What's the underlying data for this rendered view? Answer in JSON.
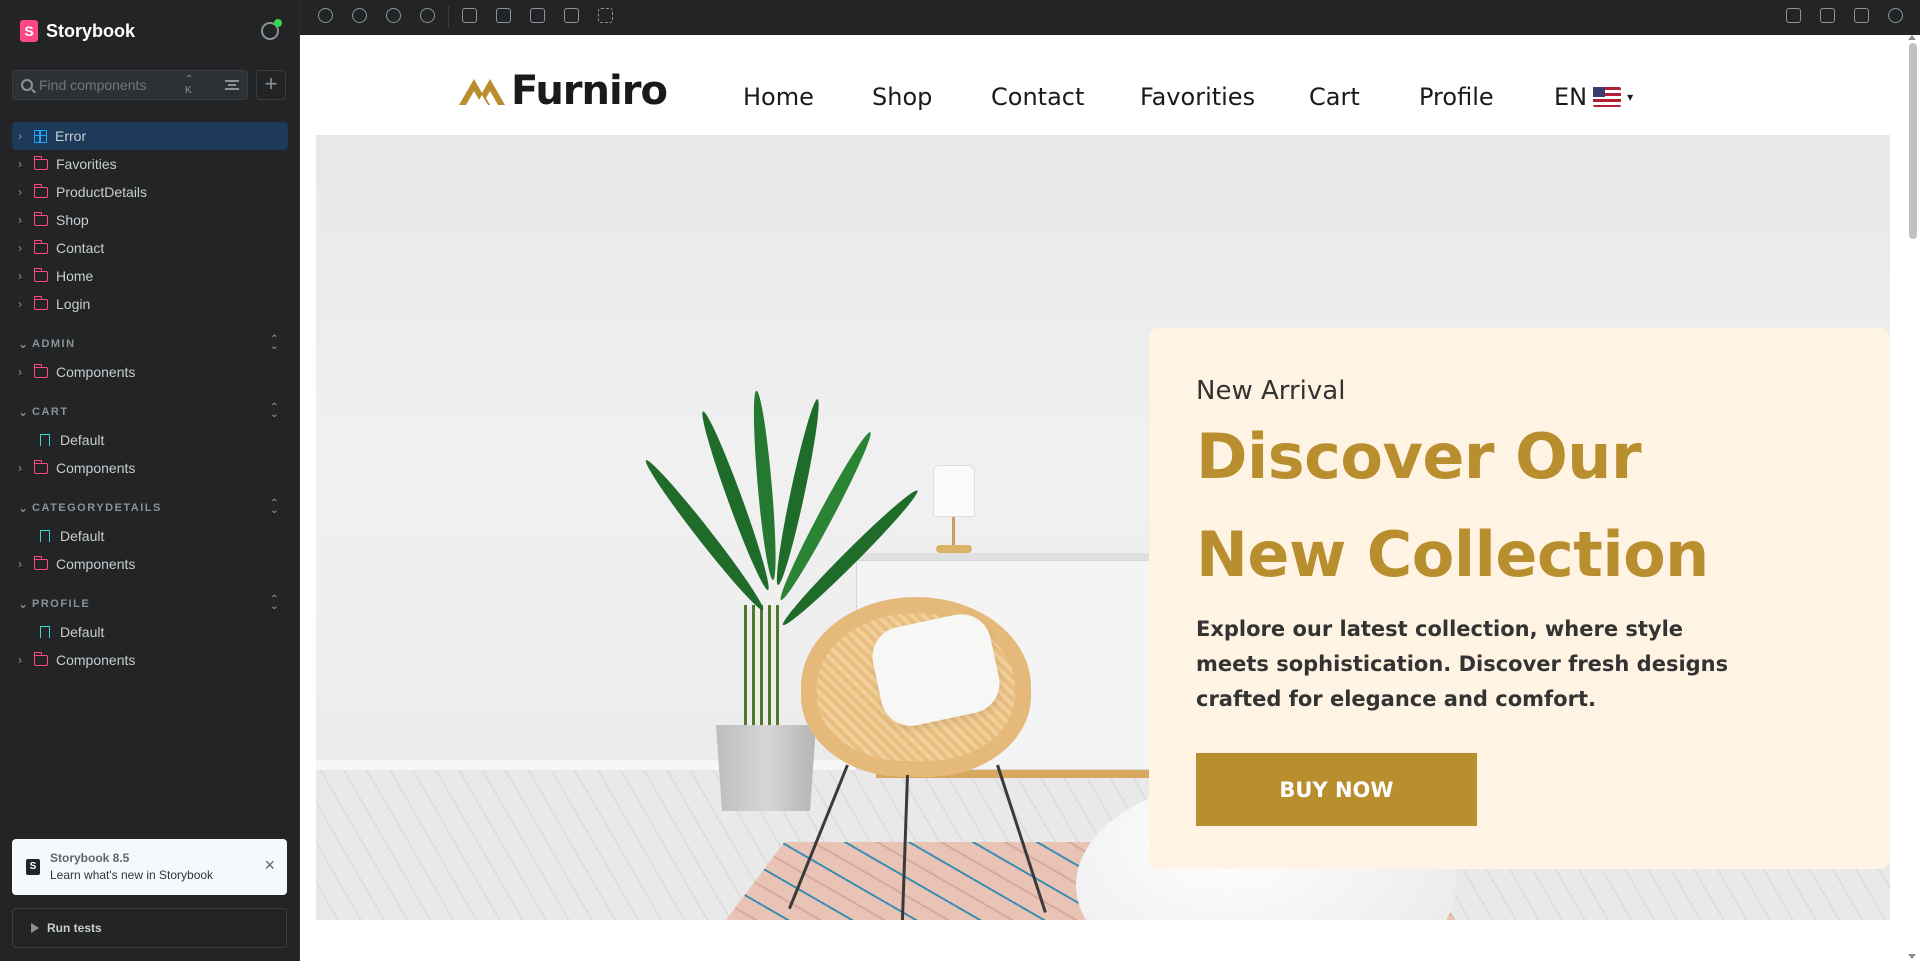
{
  "sidebar": {
    "brand": "Storybook",
    "search_placeholder": "Find components",
    "search_shortcut": "⌃ K",
    "root_items": [
      {
        "label": "Error",
        "icon": "component-icon"
      },
      {
        "label": "Favorities",
        "icon": "folder-icon"
      },
      {
        "label": "ProductDetails",
        "icon": "folder-icon"
      },
      {
        "label": "Shop",
        "icon": "folder-icon"
      },
      {
        "label": "Contact",
        "icon": "folder-icon"
      },
      {
        "label": "Home",
        "icon": "folder-icon"
      },
      {
        "label": "Login",
        "icon": "folder-icon"
      }
    ],
    "sections": [
      {
        "title": "ADMIN",
        "items": [
          {
            "label": "Components",
            "icon": "folder-icon"
          }
        ]
      },
      {
        "title": "CART",
        "items": [
          {
            "label": "Default",
            "icon": "bookmark-icon"
          },
          {
            "label": "Components",
            "icon": "folder-icon"
          }
        ]
      },
      {
        "title": "CATEGORYDETAILS",
        "items": [
          {
            "label": "Default",
            "icon": "bookmark-icon"
          },
          {
            "label": "Components",
            "icon": "folder-icon"
          }
        ]
      },
      {
        "title": "PROFILE",
        "items": [
          {
            "label": "Default",
            "icon": "bookmark-icon"
          },
          {
            "label": "Components",
            "icon": "folder-icon"
          }
        ]
      }
    ],
    "whatsnew": {
      "title": "Storybook 8.5",
      "subtitle": "Learn what's new in Storybook"
    },
    "run_tests": "Run tests"
  },
  "preview": {
    "logo_text": "Furniro",
    "nav": [
      "Home",
      "Shop",
      "Contact",
      "Favorities",
      "Cart",
      "Profile"
    ],
    "language": "EN",
    "hero": {
      "eyebrow": "New Arrival",
      "title_line1": "Discover Our",
      "title_line2": "New Collection",
      "description": "Explore our latest collection, where style meets sophistication. Discover fresh designs crafted for elegance and comfort.",
      "cta": "BUY NOW"
    }
  },
  "colors": {
    "accent": "#b88e2f",
    "card_bg": "#fff3e3",
    "sidebar_bg": "#222425",
    "active_item": "#1e3a5a",
    "folder": "#ff4785"
  }
}
